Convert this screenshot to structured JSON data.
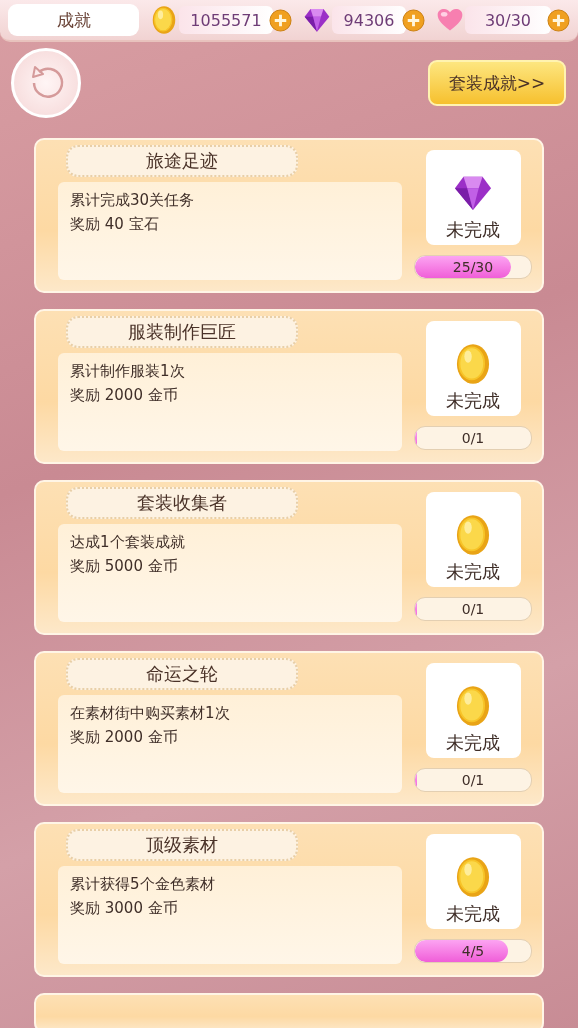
{
  "header": {
    "title": "成就",
    "currencies": [
      {
        "kind": "coin",
        "value": "1055571"
      },
      {
        "kind": "gem",
        "value": "94306"
      },
      {
        "kind": "heart",
        "value": "30/30"
      }
    ]
  },
  "set_button": "套装成就>>",
  "achievements": [
    {
      "title": "旅途足迹",
      "description": "累计完成30关任务",
      "reward": "奖励 40 宝石",
      "kind": "gem",
      "status": "未完成",
      "progress": "25/30",
      "level": 0.83
    },
    {
      "title": "服装制作巨匠",
      "description": "累计制作服装1次",
      "reward": "奖励 2000 金币",
      "kind": "coin",
      "status": "未完成",
      "progress": "0/1",
      "level": 0
    },
    {
      "title": "套装收集者",
      "description": "达成1个套装成就",
      "reward": "奖励 5000 金币",
      "kind": "coin",
      "status": "未完成",
      "progress": "0/1",
      "level": 0
    },
    {
      "title": "命运之轮",
      "description": "在素材街中购买素材1次",
      "reward": "奖励 2000 金币",
      "kind": "coin",
      "status": "未完成",
      "progress": "0/1",
      "level": 0
    },
    {
      "title": "顶级素材",
      "description": "累计获得5个金色素材",
      "reward": "奖励 3000 金币",
      "kind": "coin",
      "status": "未完成",
      "progress": "4/5",
      "level": 0.8
    }
  ]
}
